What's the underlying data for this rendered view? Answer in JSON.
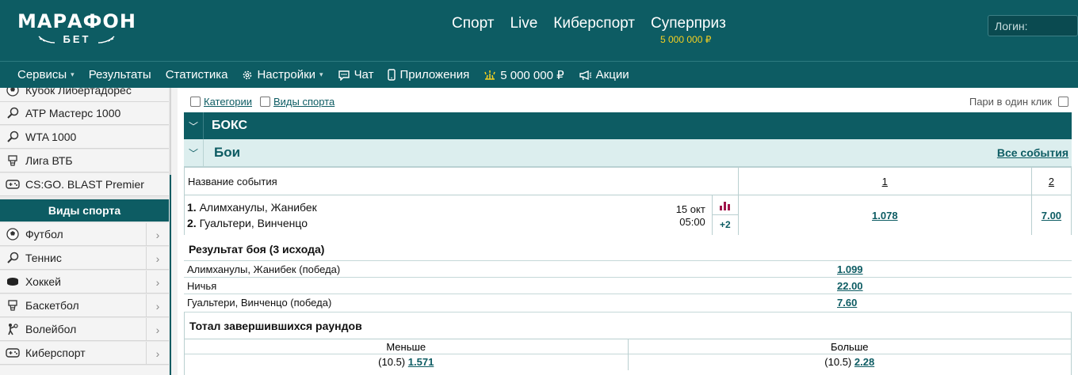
{
  "brand": {
    "name": "МАРАФОН",
    "sub": "БЕТ"
  },
  "main_nav": [
    {
      "label": "Спорт"
    },
    {
      "label": "Live"
    },
    {
      "label": "Киберспорт"
    },
    {
      "label": "Суперприз",
      "sub": "5 000 000 ₽"
    }
  ],
  "login": {
    "placeholder": "Логин:"
  },
  "sub_nav": [
    {
      "label": "Сервисы",
      "icon": "none",
      "caret": true
    },
    {
      "label": "Результаты"
    },
    {
      "label": "Статистика"
    },
    {
      "label": "Настройки",
      "icon": "gear-icon",
      "caret": true
    },
    {
      "label": "Чат",
      "icon": "chat-icon"
    },
    {
      "label": "Приложения",
      "icon": "phone-icon"
    },
    {
      "label": "5 000 000 ₽",
      "icon": "prize-icon"
    },
    {
      "label": "Акции",
      "icon": "megaphone-icon"
    }
  ],
  "sidebar": {
    "top_items": [
      {
        "label": "Кубок Либертадорес",
        "icon": "football-icon"
      },
      {
        "label": "ATP Мастерс 1000",
        "icon": "tennis-icon"
      },
      {
        "label": "WTA 1000",
        "icon": "tennis-icon"
      },
      {
        "label": "Лига ВТБ",
        "icon": "basketball-icon"
      },
      {
        "label": "CS:GO. BLAST Premier",
        "icon": "gamepad-icon"
      }
    ],
    "section_title": "Виды спорта",
    "sports": [
      {
        "label": "Футбол",
        "icon": "football-icon"
      },
      {
        "label": "Теннис",
        "icon": "tennis-icon"
      },
      {
        "label": "Хоккей",
        "icon": "puck-icon"
      },
      {
        "label": "Баскетбол",
        "icon": "basketball-icon"
      },
      {
        "label": "Волейбол",
        "icon": "volleyball-icon"
      },
      {
        "label": "Киберспорт",
        "icon": "gamepad-icon"
      }
    ]
  },
  "filters": {
    "categories": "Категории",
    "sports": "Виды спорта",
    "one_click": "Пари в один клик"
  },
  "sport": {
    "title": "БОКС"
  },
  "league": {
    "title": "Бои",
    "all_events": "Все события"
  },
  "event_table": {
    "header_name": "Название события",
    "col1": "1",
    "col2": "2",
    "event": {
      "p1_num": "1.",
      "p1": "Алимханулы, Жанибек",
      "p2_num": "2.",
      "p2": "Гуальтери, Винченцо",
      "date": "15 окт",
      "time": "05:00",
      "more": "+2",
      "odd1": "1.078",
      "odd2": "7.00"
    }
  },
  "market_result": {
    "title": "Результат боя (3 исхода)",
    "rows": [
      {
        "label": "Алимханулы, Жанибек (победа)",
        "odd": "1.099"
      },
      {
        "label": "Ничья",
        "odd": "22.00"
      },
      {
        "label": "Гуальтери, Винченцо (победа)",
        "odd": "7.60"
      }
    ]
  },
  "market_total": {
    "title": "Тотал завершившихся раундов",
    "under_label": "Меньше",
    "over_label": "Больше",
    "under_line": "(10.5)",
    "under_odd": "1.571",
    "over_line": "(10.5)",
    "over_odd": "2.28"
  },
  "colors": {
    "primary": "#0d5c63",
    "league_bg": "#dceeee",
    "prize": "#f5d020",
    "stat": "#a0144a"
  }
}
